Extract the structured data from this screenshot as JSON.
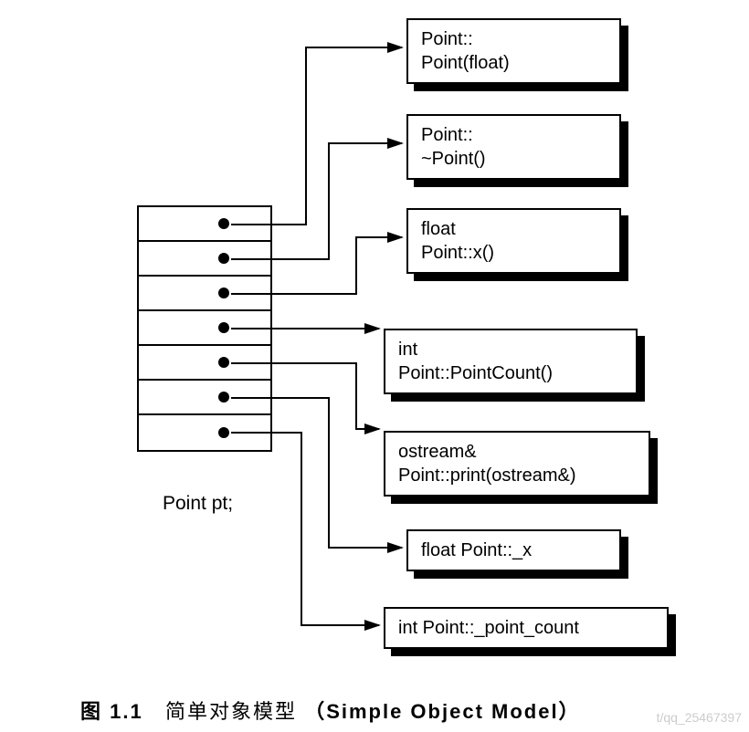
{
  "pt_label": "Point pt;",
  "boxes": [
    {
      "line1": "Point::",
      "line2": "Point(float)"
    },
    {
      "line1": "Point::",
      "line2": "~Point()"
    },
    {
      "line1": "float",
      "line2": "Point::x()"
    },
    {
      "line1": "int",
      "line2": "Point::PointCount()"
    },
    {
      "line1": "ostream&",
      "line2": "Point::print(ostream&)"
    },
    {
      "line1": "float Point::_x",
      "line2": ""
    },
    {
      "line1": "int Point::_point_count",
      "line2": ""
    }
  ],
  "caption_figno": "图 1.1",
  "caption_zh": "简单对象模型",
  "caption_en": "（Simple Object Model）",
  "watermark": "t/qq_25467397"
}
